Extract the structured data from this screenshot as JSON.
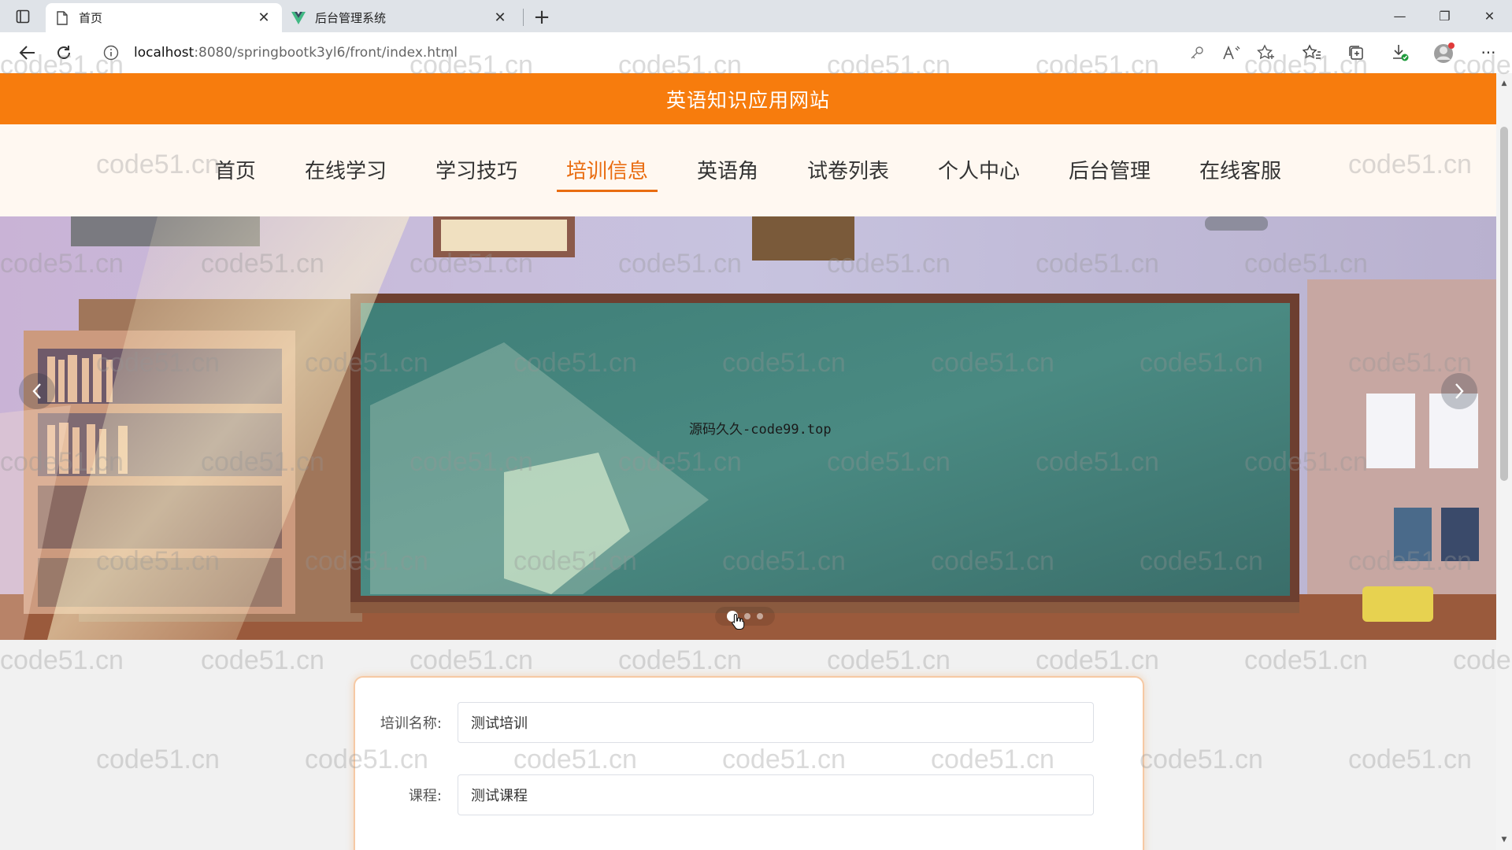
{
  "browser": {
    "tabs": [
      {
        "title": "首页",
        "active": true
      },
      {
        "title": "后台管理系统",
        "active": false
      }
    ],
    "url_host": "localhost",
    "url_path": ":8080/springbootk3yl6/front/index.html"
  },
  "site": {
    "title": "英语知识应用网站",
    "nav": [
      {
        "label": "首页",
        "active": false
      },
      {
        "label": "在线学习",
        "active": false
      },
      {
        "label": "学习技巧",
        "active": false
      },
      {
        "label": "培训信息",
        "active": true
      },
      {
        "label": "英语角",
        "active": false
      },
      {
        "label": "试卷列表",
        "active": false
      },
      {
        "label": "个人中心",
        "active": false
      },
      {
        "label": "后台管理",
        "active": false
      },
      {
        "label": "在线客服",
        "active": false
      }
    ]
  },
  "banner": {
    "caption": "源码久久-code99.top",
    "slide_count": 3,
    "active_slide": 1
  },
  "form": {
    "training_name_label": "培训名称:",
    "training_name_value": "测试培训",
    "course_label": "课程:",
    "course_value": "测试课程"
  },
  "watermark": "code51.cn"
}
